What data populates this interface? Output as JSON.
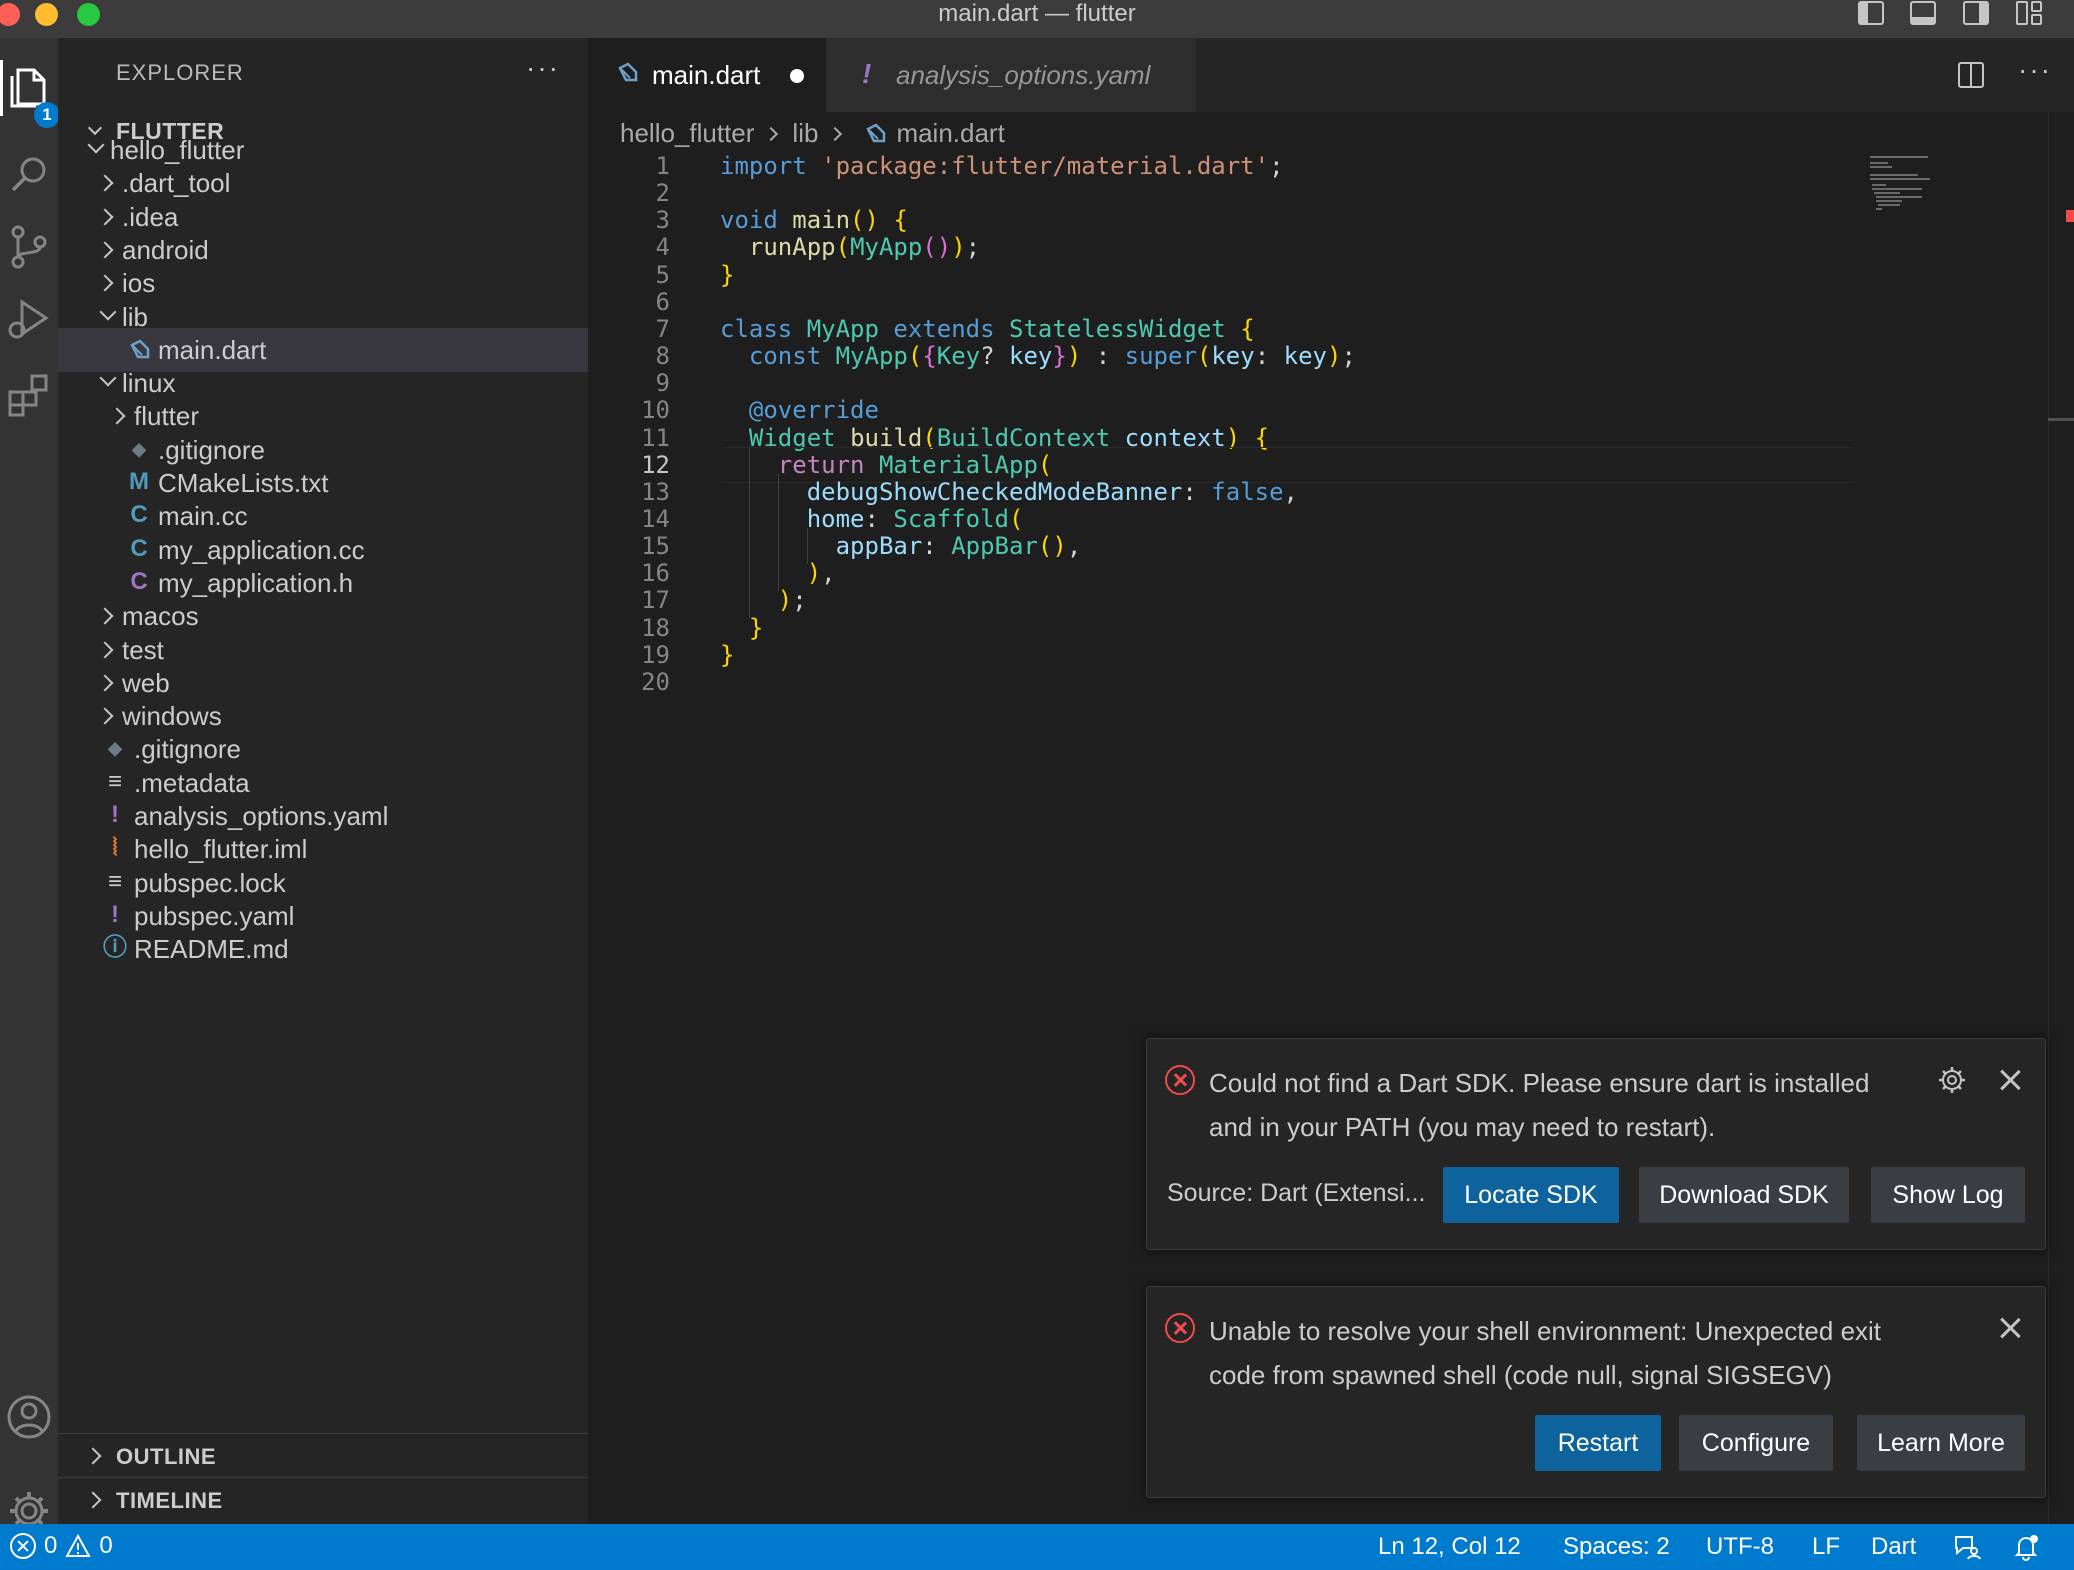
{
  "window": {
    "title": "main.dart — flutter"
  },
  "activity_bar": {
    "explorer_badge": "1"
  },
  "sidebar": {
    "title": "EXPLORER",
    "root": "FLUTTER",
    "tree": [
      {
        "label": "hello_flutter",
        "icon": "folder-open",
        "icon_char": ""
      },
      {
        "label": ".dart_tool",
        "icon": "folder-closed",
        "icon_char": ""
      },
      {
        "label": ".idea",
        "icon": "folder-closed",
        "icon_char": ""
      },
      {
        "label": "android",
        "icon": "folder-closed",
        "icon_char": ""
      },
      {
        "label": "ios",
        "icon": "folder-closed",
        "icon_char": ""
      },
      {
        "label": "lib",
        "icon": "folder-open",
        "icon_char": ""
      },
      {
        "label": "main.dart",
        "icon": "dart-file-icon",
        "icon_char": ""
      },
      {
        "label": "linux",
        "icon": "folder-open",
        "icon_char": ""
      },
      {
        "label": "flutter",
        "icon": "folder-closed",
        "icon_char": ""
      },
      {
        "label": ".gitignore",
        "icon": "git-icon",
        "icon_char": "◆"
      },
      {
        "label": "CMakeLists.txt",
        "icon": "cmake-icon",
        "icon_char": "M"
      },
      {
        "label": "main.cc",
        "icon": "cpp-icon",
        "icon_char": "C"
      },
      {
        "label": "my_application.cc",
        "icon": "cpp-icon",
        "icon_char": "C"
      },
      {
        "label": "my_application.h",
        "icon": "c-header-icon",
        "icon_char": "C"
      },
      {
        "label": "macos",
        "icon": "folder-closed",
        "icon_char": ""
      },
      {
        "label": "test",
        "icon": "folder-closed",
        "icon_char": ""
      },
      {
        "label": "web",
        "icon": "folder-closed",
        "icon_char": ""
      },
      {
        "label": "windows",
        "icon": "folder-closed",
        "icon_char": ""
      },
      {
        "label": ".gitignore",
        "icon": "git-icon",
        "icon_char": "◆"
      },
      {
        "label": ".metadata",
        "icon": "lines-icon",
        "icon_char": "≡"
      },
      {
        "label": "analysis_options.yaml",
        "icon": "yaml-icon",
        "icon_char": "!"
      },
      {
        "label": "hello_flutter.iml",
        "icon": "rss-icon",
        "icon_char": "⦚"
      },
      {
        "label": "pubspec.lock",
        "icon": "lines-icon",
        "icon_char": "≡"
      },
      {
        "label": "pubspec.yaml",
        "icon": "yaml-icon",
        "icon_char": "!"
      },
      {
        "label": "README.md",
        "icon": "info-icon",
        "icon_char": "ⓘ"
      }
    ],
    "outline": "OUTLINE",
    "timeline": "TIMELINE"
  },
  "tabs": [
    {
      "label": "main.dart",
      "active": true,
      "modified": true
    },
    {
      "label": "analysis_options.yaml",
      "active": false,
      "modified": false
    }
  ],
  "breadcrumb": [
    "hello_flutter",
    "lib",
    "main.dart"
  ],
  "code": {
    "current_line": 12,
    "lines": [
      "import 'package:flutter/material.dart';",
      "",
      "void main() {",
      "  runApp(MyApp());",
      "}",
      "",
      "class MyApp extends StatelessWidget {",
      "  const MyApp({Key? key}) : super(key: key);",
      "",
      "  @override",
      "  Widget build(BuildContext context) {",
      "    return MaterialApp(",
      "      debugShowCheckedModeBanner: false,",
      "      home: Scaffold(",
      "        appBar: AppBar(),",
      "      ),",
      "    );",
      "  }",
      "}",
      ""
    ]
  },
  "notifications": [
    {
      "message": "Could not find a Dart SDK. Please ensure dart is installed and in your PATH (you may need to restart).",
      "source": "Source: Dart (Extensi...",
      "buttons": [
        "Locate SDK",
        "Download SDK",
        "Show Log"
      ]
    },
    {
      "message": "Unable to resolve your shell environment: Unexpected exit code from spawned shell (code null, signal SIGSEGV)",
      "buttons": [
        "Restart",
        "Configure",
        "Learn More"
      ]
    }
  ],
  "status_bar": {
    "errors": "0",
    "warnings": "0",
    "position": "Ln 12, Col 12",
    "spaces": "Spaces: 2",
    "encoding": "UTF-8",
    "eol": "LF",
    "language": "Dart"
  },
  "colors": {
    "accent": "#007acc",
    "error": "#f14c4c",
    "button_primary": "#0e639c"
  }
}
